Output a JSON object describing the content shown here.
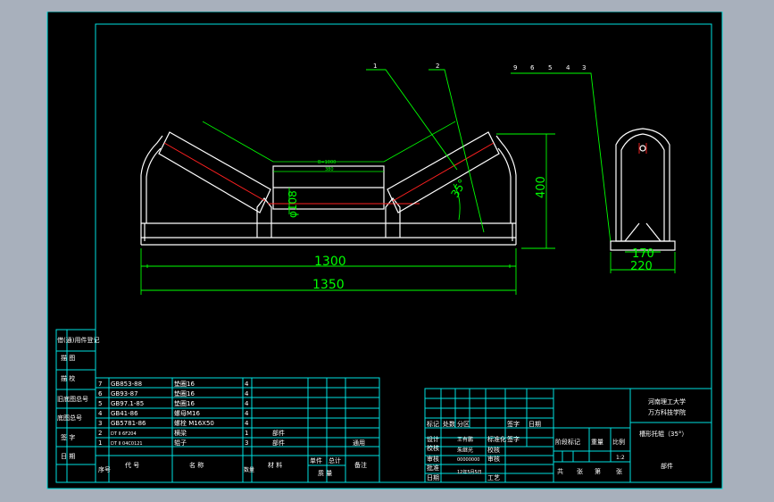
{
  "drawing": {
    "dimensions": {
      "d1300": "1300",
      "d1350": "1350",
      "d400": "400",
      "d108": "φ108",
      "angle": "35°",
      "d170": "170",
      "d220": "220",
      "small_top": "B=1000",
      "small_mid": "380"
    },
    "balloons": {
      "b1": "1",
      "b2": "2",
      "b9": "9",
      "b6": "6",
      "b5": "5",
      "b4": "4",
      "b3": "3"
    }
  },
  "left_strip": [
    "借(通)用件登记",
    "描 图",
    "描 校",
    "旧底图总号",
    "底图总号",
    "签 字",
    "日 期"
  ],
  "parts_list": {
    "rows": [
      {
        "no": "7",
        "code": "GB853-88",
        "name": "垫圈16",
        "qty": "4",
        "material": "",
        "single": "",
        "total": "",
        "remark": ""
      },
      {
        "no": "6",
        "code": "GB93-87",
        "name": "垫圈16",
        "qty": "4",
        "material": "",
        "single": "",
        "total": "",
        "remark": ""
      },
      {
        "no": "5",
        "code": "GB97.1-85",
        "name": "垫圈16",
        "qty": "4",
        "material": "",
        "single": "",
        "total": "",
        "remark": ""
      },
      {
        "no": "4",
        "code": "GB41-86",
        "name": "螺母M16",
        "qty": "4",
        "material": "",
        "single": "",
        "total": "",
        "remark": ""
      },
      {
        "no": "3",
        "code": "GB5781-86",
        "name": "螺栓 M16X50",
        "qty": "4",
        "material": "",
        "single": "",
        "total": "",
        "remark": ""
      },
      {
        "no": "2",
        "code": "DT II 6F204",
        "name": "横梁",
        "qty": "1",
        "material": "部件",
        "single": "",
        "total": "",
        "remark": ""
      },
      {
        "no": "1",
        "code": "DT II 04C0121",
        "name": "辊子",
        "qty": "3",
        "material": "部件",
        "single": "",
        "total": "",
        "remark": "通用"
      }
    ],
    "header": {
      "no": "序号",
      "code": "代 号",
      "name": "名 称",
      "qty": "数量",
      "material": "材 料",
      "single": "单件",
      "total": "总计",
      "weight": "质 量",
      "remark": "备注"
    }
  },
  "title_block": {
    "org": "河南理工大学",
    "org_sub": "万方科技学院",
    "drawing_name": "槽形托辊（35°）",
    "labels": {
      "mark": "标记",
      "count": "处数",
      "zone": "分区",
      "change_doc": "更改文件号",
      "sign": "签字",
      "date": "日期",
      "design": "设计",
      "draw": "校核",
      "review": "审核",
      "craft": "工艺",
      "std": "标准化",
      "approve": "批准",
      "stage_mark": "阶段标记",
      "weight": "重量",
      "scale": "比例",
      "total_sheets": "共",
      "sheets": "张",
      "sheet_no": "第",
      "sheet": "张"
    },
    "values": {
      "designer": "王有鹏",
      "checker": "朱继光",
      "std_val": "00000000",
      "date_val": "12年5月5日",
      "scale": "1:2",
      "part_type": "部件"
    }
  }
}
